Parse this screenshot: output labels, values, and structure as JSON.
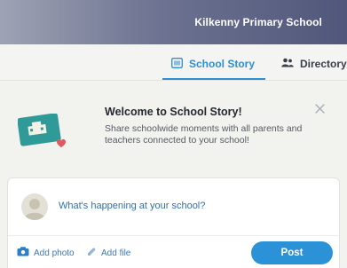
{
  "header": {
    "school_name": "Kilkenny Primary School"
  },
  "tabs": [
    {
      "label": "School Story",
      "icon": "school-story-icon",
      "active": true
    },
    {
      "label": "Directory",
      "icon": "people-icon",
      "active": false
    }
  ],
  "welcome": {
    "title": "Welcome to School Story!",
    "body": "Share schoolwide moments with all parents and teachers connected to your school!"
  },
  "composer": {
    "prompt": "What's happening at your school?",
    "add_photo": "Add photo",
    "add_file": "Add file",
    "post": "Post"
  },
  "colors": {
    "accent": "#2f8fcf",
    "post_button": "#2c92d8",
    "header": "#5a6183"
  }
}
